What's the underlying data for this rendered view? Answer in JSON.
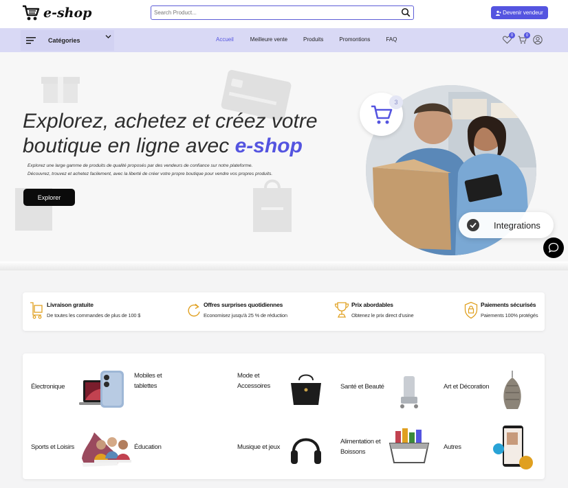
{
  "header": {
    "logo_text": "e-shop",
    "search_placeholder": "Search Product...",
    "seller_button": "Devenir vendeur"
  },
  "nav": {
    "categories_label": "Catégories",
    "links": [
      "Accueil",
      "Meilleure vente",
      "Produits",
      "Promontions",
      "FAQ"
    ],
    "wishlist_count": "0",
    "cart_count": "0"
  },
  "hero": {
    "title_part1": "Explorez, achetez et créez votre boutique en ligne avec ",
    "title_brand": "e-shop",
    "desc_line1": "Explorez une large gamme de produits de qualité proposés par des vendeurs de confiance sur notre plateforme.",
    "desc_line2": "Découvrez, trouvez et achetez facilement, avec la liberté de créer votre propre boutique pour vendre vos propres produits.",
    "explore_button": "Explorer",
    "cart_badge": "3",
    "integrations_label": "Integrations"
  },
  "features": [
    {
      "title": "Livraison gratuite",
      "subtitle": "De toutes les commandes de plus de 100 $",
      "icon": "delivery-cart-icon"
    },
    {
      "title": "Offres surprises quotidiennes",
      "subtitle": "Economisez jusqu'à 25 % de réduction",
      "icon": "refresh-icon"
    },
    {
      "title": "Prix abordables",
      "subtitle": "Obtenez le prix direct d'usine",
      "icon": "trophy-icon"
    },
    {
      "title": "Paiements sécurisés",
      "subtitle": "Paiements 100% protégés",
      "icon": "shield-lock-icon"
    }
  ],
  "categories": [
    {
      "label": "Électronique",
      "image": "laptop-image"
    },
    {
      "label": "Mobiles et tablettes",
      "image": "phone-image"
    },
    {
      "label": "Mode et Accessoires",
      "image": "handbag-image"
    },
    {
      "label": "Santé et Beauté",
      "image": "beauty-product-image"
    },
    {
      "label": "Art et Décoration",
      "image": "lamp-image"
    },
    {
      "label": "Sports et Loisirs",
      "image": "sneaker-image"
    },
    {
      "label": "Éducation",
      "image": "students-image"
    },
    {
      "label": "Musique et jeux",
      "image": "headphones-image"
    },
    {
      "label": "Alimentation et Boissons",
      "image": "grocery-basket-image"
    },
    {
      "label": "Autres",
      "image": "mobile-shop-image"
    }
  ],
  "colors": {
    "accent": "#5454e0",
    "nav_bg": "#d9d9f5",
    "feature_icon": "#e0a020"
  }
}
